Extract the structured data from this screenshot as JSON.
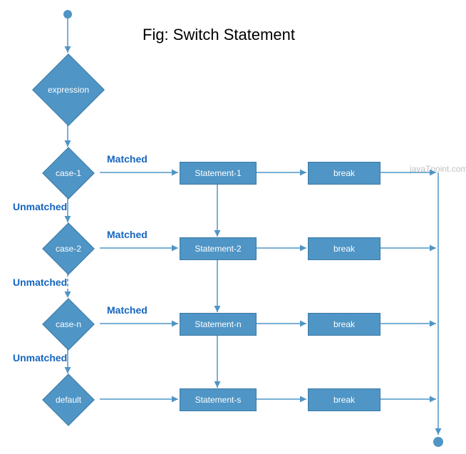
{
  "title": "Fig: Switch Statement",
  "watermark": "javaTpoint.com",
  "nodes": {
    "expression": "expression",
    "case1": "case-1",
    "case2": "case-2",
    "casen": "case-n",
    "default": "default",
    "stmt1": "Statement-1",
    "stmt2": "Statement-2",
    "stmtn": "Statement-n",
    "stmts": "Statement-s",
    "break1": "break",
    "break2": "break",
    "breakn": "break",
    "breaks": "break"
  },
  "edges": {
    "matched1": "Matched",
    "matched2": "Matched",
    "matchedn": "Matched",
    "unmatched1": "Unmatched",
    "unmatched2": "Unmatched",
    "unmatchedn": "Unmatched"
  }
}
